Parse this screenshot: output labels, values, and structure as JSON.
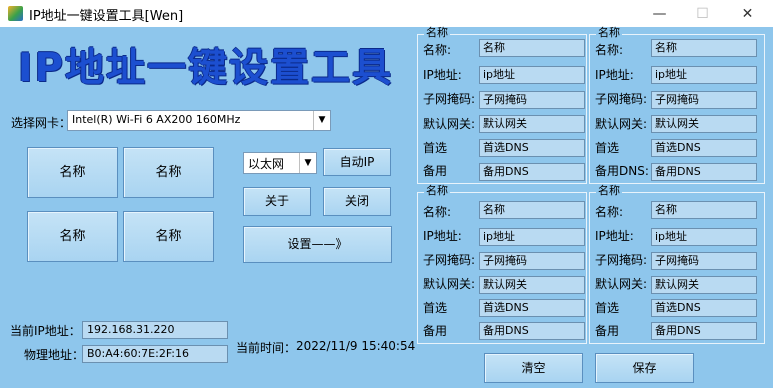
{
  "window": {
    "title": "IP地址一键设置工具[Wen]",
    "minimize": "—",
    "maximize": "☐",
    "close": "✕"
  },
  "header": {
    "big_title": "IP地址一键设置工具"
  },
  "adapter": {
    "label": "选择网卡：",
    "selected": "Intel(R) Wi-Fi 6 AX200 160MHz"
  },
  "presets": [
    "名称",
    "名称",
    "名称",
    "名称"
  ],
  "connection_type": {
    "selected": "以太网"
  },
  "buttons": {
    "auto_ip": "自动IP",
    "about": "关于",
    "close": "关闭",
    "apply": "设置——》",
    "clear": "清空",
    "save": "保存"
  },
  "status": {
    "current_ip_label": "当前IP地址：",
    "current_ip": "192.168.31.220",
    "mac_label": "物理地址：",
    "mac": "B0:A4:60:7E:2F:16",
    "time_label": "当前时间：",
    "time": "2022/11/9 15:40:54"
  },
  "groups": [
    {
      "title": "名称",
      "rows": [
        {
          "label": "名称:",
          "value": "名称"
        },
        {
          "label": "IP地址:",
          "value": "ip地址"
        },
        {
          "label": "子网掩码:",
          "value": "子网掩码"
        },
        {
          "label": "默认网关:",
          "value": "默认网关"
        },
        {
          "label": "首选",
          "value": "首选DNS"
        },
        {
          "label": "备用",
          "value": "备用DNS"
        }
      ]
    },
    {
      "title": "名称",
      "rows": [
        {
          "label": "名称:",
          "value": "名称"
        },
        {
          "label": "IP地址:",
          "value": "ip地址"
        },
        {
          "label": "子网掩码:",
          "value": "子网掩码"
        },
        {
          "label": "默认网关:",
          "value": "默认网关"
        },
        {
          "label": "首选",
          "value": "首选DNS"
        },
        {
          "label": "备用DNS:",
          "value": "备用DNS"
        }
      ]
    },
    {
      "title": "名称",
      "rows": [
        {
          "label": "名称:",
          "value": "名称"
        },
        {
          "label": "IP地址:",
          "value": "ip地址"
        },
        {
          "label": "子网掩码:",
          "value": "子网掩码"
        },
        {
          "label": "默认网关:",
          "value": "默认网关"
        },
        {
          "label": "首选",
          "value": "首选DNS"
        },
        {
          "label": "备用",
          "value": "备用DNS"
        }
      ]
    },
    {
      "title": "名称",
      "rows": [
        {
          "label": "名称:",
          "value": "名称"
        },
        {
          "label": "IP地址:",
          "value": "ip地址"
        },
        {
          "label": "子网掩码:",
          "value": "子网掩码"
        },
        {
          "label": "默认网关:",
          "value": "默认网关"
        },
        {
          "label": "首选",
          "value": "首选DNS"
        },
        {
          "label": "备用",
          "value": "备用DNS"
        }
      ]
    }
  ]
}
